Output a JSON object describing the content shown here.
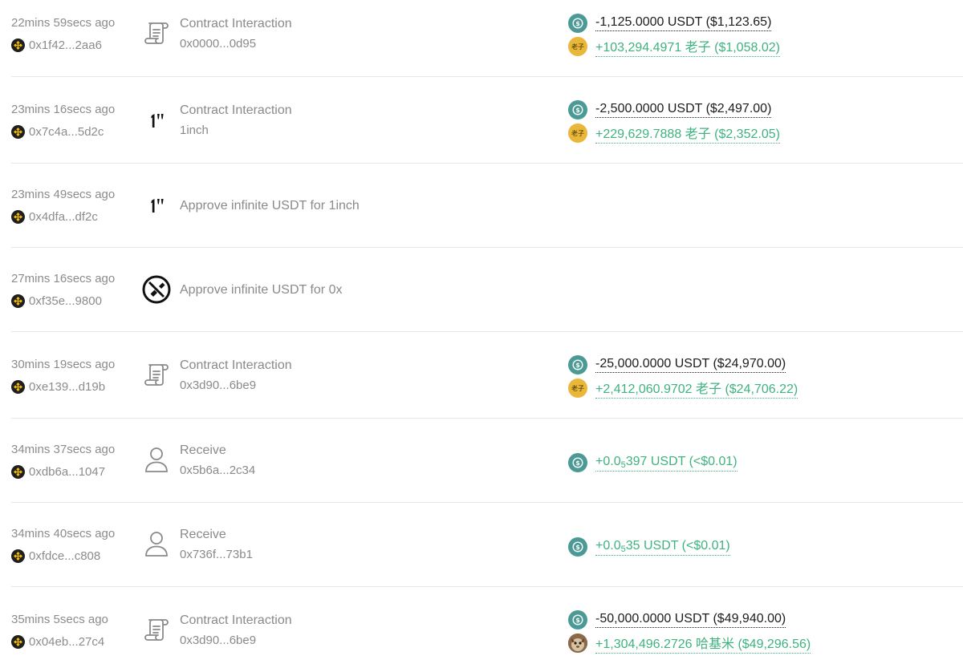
{
  "transactions": [
    {
      "time": "22mins 59secs ago",
      "address": "0x1f42...2aa6",
      "icon": "contract-scroll-icon",
      "title": "Contract Interaction",
      "subtitle": "0x0000...0d95",
      "changes": [
        {
          "token_icon": "usdt-icon",
          "text": "-1,125.0000 USDT ($1,123.65)",
          "direction": "out"
        },
        {
          "token_icon": "laozi-icon",
          "text": "+103,294.4971 老子 ($1,058.02)",
          "direction": "in"
        }
      ]
    },
    {
      "time": "23mins 16secs ago",
      "address": "0x7c4a...5d2c",
      "icon": "oneinch-icon",
      "title": "Contract Interaction",
      "subtitle": "1inch",
      "changes": [
        {
          "token_icon": "usdt-icon",
          "text": "-2,500.0000 USDT ($2,497.00)",
          "direction": "out"
        },
        {
          "token_icon": "laozi-icon",
          "text": "+229,629.7888 老子 ($2,352.05)",
          "direction": "in"
        }
      ]
    },
    {
      "time": "23mins 49secs ago",
      "address": "0x4dfa...df2c",
      "icon": "oneinch-icon",
      "title": "Approve infinite USDT for 1inch",
      "subtitle": "",
      "changes": []
    },
    {
      "time": "27mins 16secs ago",
      "address": "0xf35e...9800",
      "icon": "zerox-icon",
      "title": "Approve infinite USDT for 0x",
      "subtitle": "",
      "changes": []
    },
    {
      "time": "30mins 19secs ago",
      "address": "0xe139...d19b",
      "icon": "contract-scroll-icon",
      "title": "Contract Interaction",
      "subtitle": "0x3d90...6be9",
      "changes": [
        {
          "token_icon": "usdt-icon",
          "text": "-25,000.0000 USDT ($24,970.00)",
          "direction": "out"
        },
        {
          "token_icon": "laozi-icon",
          "text": "+2,412,060.9702 老子 ($24,706.22)",
          "direction": "in"
        }
      ]
    },
    {
      "time": "34mins 37secs ago",
      "address": "0xdb6a...1047",
      "icon": "user-icon",
      "title": "Receive",
      "subtitle": "0x5b6a...2c34",
      "changes": [
        {
          "token_icon": "usdt-icon",
          "direction": "in",
          "prefix": "+0.0",
          "sub": "5",
          "rest": "397",
          "unit": " USDT (<$0.01)"
        }
      ]
    },
    {
      "time": "34mins 40secs ago",
      "address": "0xfdce...c808",
      "icon": "user-icon",
      "title": "Receive",
      "subtitle": "0x736f...73b1",
      "changes": [
        {
          "token_icon": "usdt-icon",
          "direction": "in",
          "prefix": "+0.0",
          "sub": "5",
          "rest": "35",
          "unit": " USDT (<$0.01)"
        }
      ]
    },
    {
      "time": "35mins 5secs ago",
      "address": "0x04eb...27c4",
      "icon": "contract-scroll-icon",
      "title": "Contract Interaction",
      "subtitle": "0x3d90...6be9",
      "changes": [
        {
          "token_icon": "usdt-icon",
          "text": "-50,000.0000 USDT ($49,940.00)",
          "direction": "out"
        },
        {
          "token_icon": "hajimi-icon",
          "text": "+1,304,496.2726 哈基米 ($49,296.56)",
          "direction": "in"
        }
      ]
    }
  ],
  "token_icon_labels": {
    "laozi": "老子"
  },
  "colors": {
    "incoming": "#3fb37f",
    "outgoing": "#1c1c1c",
    "usdt": "#4b9a95",
    "laozi": "#e9b73a",
    "chain_badge": "#f0b90b"
  }
}
